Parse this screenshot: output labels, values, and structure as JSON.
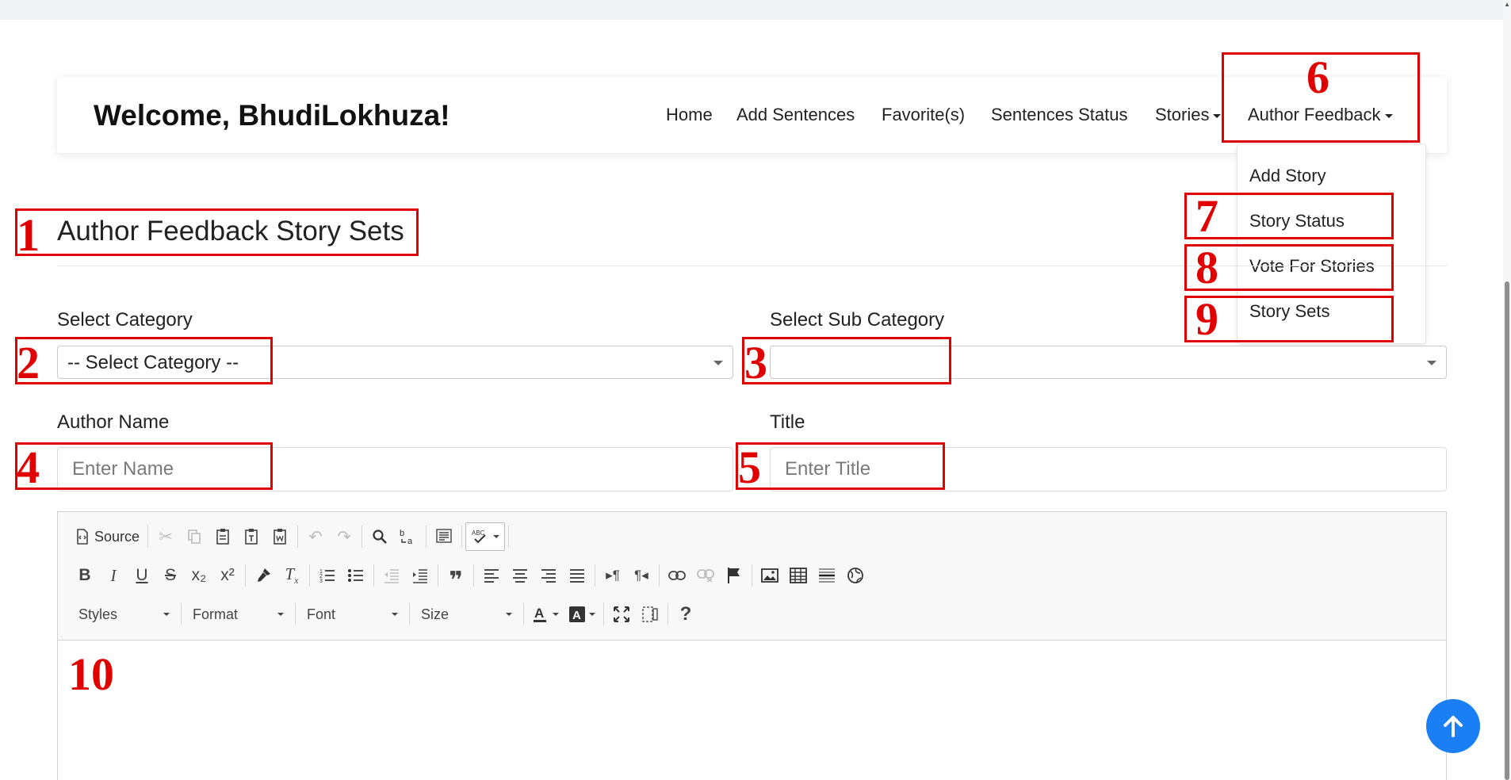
{
  "navbar": {
    "brand": "Welcome, BhudiLokhuza!",
    "items": [
      {
        "label": "Home"
      },
      {
        "label": "Add Sentences"
      },
      {
        "label": "Favorite(s)"
      },
      {
        "label": "Sentences Status"
      },
      {
        "label": "Stories"
      },
      {
        "label": "Author Feedback"
      }
    ]
  },
  "dropdown": {
    "items": [
      {
        "label": "Add Story"
      },
      {
        "label": "Story Status"
      },
      {
        "label": "Vote For Stories"
      },
      {
        "label": "Story Sets"
      }
    ]
  },
  "page": {
    "title": "Author Feedback Story Sets"
  },
  "form": {
    "category": {
      "label": "Select Category",
      "value": "-- Select Category --"
    },
    "sub_category": {
      "label": "Select Sub Category",
      "value": ""
    },
    "author": {
      "label": "Author Name",
      "placeholder": "Enter Name"
    },
    "title": {
      "label": "Title",
      "placeholder": "Enter Title"
    }
  },
  "editor": {
    "source_label": "Source",
    "styles_label": "Styles",
    "format_label": "Format",
    "font_label": "Font",
    "size_label": "Size",
    "help_label": "?"
  },
  "annotations": {
    "n1": "1",
    "n2": "2",
    "n3": "3",
    "n4": "4",
    "n5": "5",
    "n6": "6",
    "n7": "7",
    "n8": "8",
    "n9": "9",
    "n10": "10"
  },
  "colors": {
    "annotation": "#e00000",
    "fab": "#1a7ef5"
  }
}
